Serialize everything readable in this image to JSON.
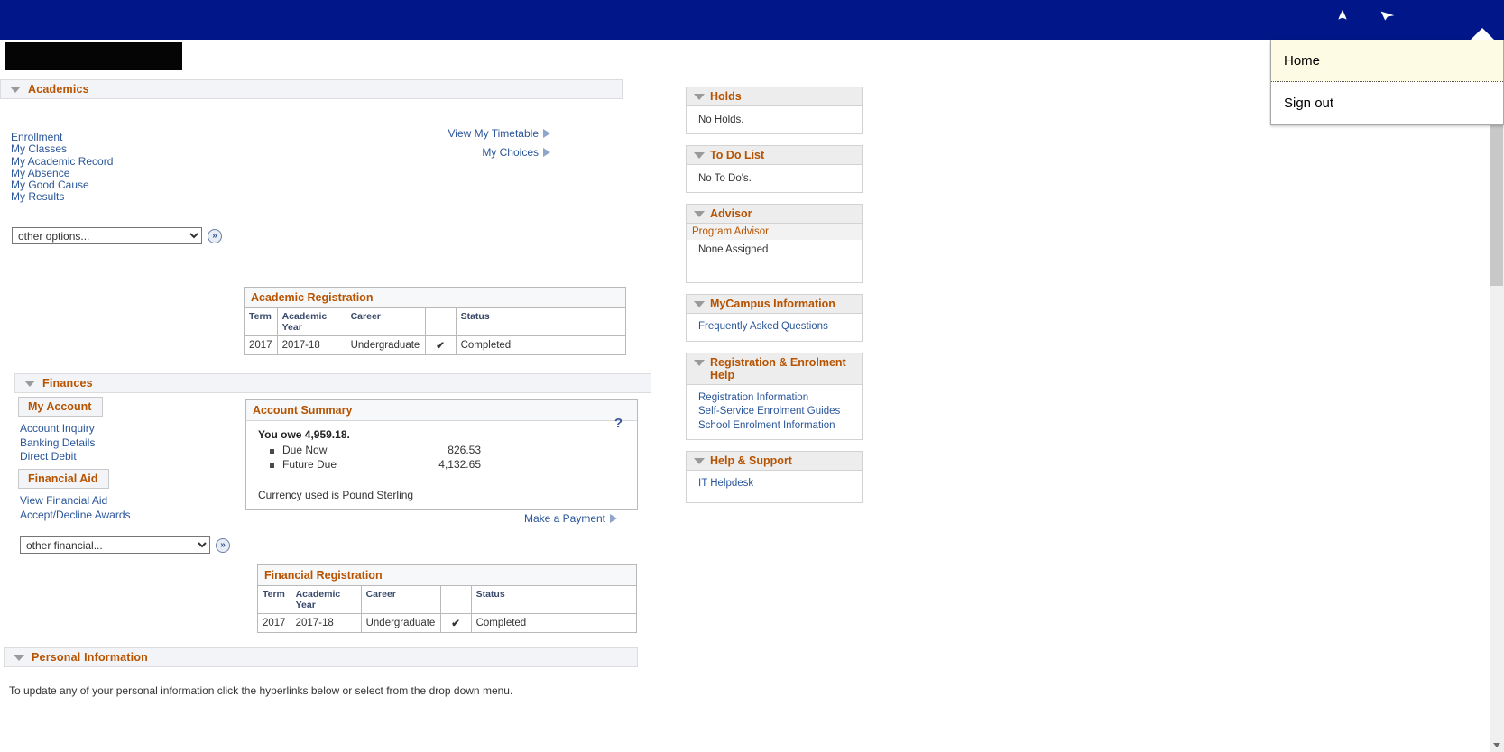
{
  "topbar": {
    "bg_color": "#001689",
    "icons": [
      {
        "name": "star-icon",
        "label": "Favourites"
      },
      {
        "name": "cursor-icon",
        "label": "Navigator"
      }
    ]
  },
  "user_menu": {
    "items": [
      {
        "label": "Home",
        "selected": true
      },
      {
        "label": "Sign out",
        "selected": false
      }
    ]
  },
  "page": {
    "redacted_title": "",
    "accent_color": "#b75300",
    "link_color": "#2a5699"
  },
  "academics": {
    "group_label": "Academics",
    "links": [
      {
        "label": "Enrollment"
      },
      {
        "label": "My Classes"
      },
      {
        "label": "My Academic Record"
      },
      {
        "label": "My Absence"
      },
      {
        "label": "My Good Cause"
      },
      {
        "label": "My Results"
      }
    ],
    "action_links": [
      {
        "label": "View My Timetable"
      },
      {
        "label": "My Choices"
      }
    ],
    "dropdown": {
      "value": "other options...",
      "options": [
        "other options..."
      ],
      "go_label": "»"
    },
    "registration_table": {
      "title": "Academic Registration",
      "columns": [
        "Term",
        "Academic Year",
        "Career",
        "",
        "Status"
      ],
      "rows": [
        [
          "2017",
          "2017-18",
          "Undergraduate",
          "✔",
          "Completed"
        ]
      ]
    }
  },
  "finances": {
    "group_label": "Finances",
    "my_account": {
      "tab_label": "My Account",
      "links": [
        {
          "label": "Account Inquiry"
        },
        {
          "label": "Banking Details"
        },
        {
          "label": "Direct Debit"
        }
      ]
    },
    "financial_aid": {
      "tab_label": "Financial Aid",
      "links": [
        {
          "label": "View Financial Aid"
        },
        {
          "label": "Accept/Decline Awards"
        }
      ]
    },
    "account_summary": {
      "title": "Account Summary",
      "owe_text": "You owe 4,959.18.",
      "rows": [
        {
          "label": "Due Now",
          "value": "826.53"
        },
        {
          "label": "Future Due",
          "value": "4,132.65"
        }
      ],
      "currency_note": "Currency used is Pound Sterling",
      "help_glyph": "?"
    },
    "make_payment_label": "Make a Payment",
    "dropdown": {
      "value": "other financial...",
      "options": [
        "other financial..."
      ],
      "go_label": "»"
    },
    "registration_table": {
      "title": "Financial Registration",
      "columns": [
        "Term",
        "Academic Year",
        "Career",
        "",
        "Status"
      ],
      "rows": [
        [
          "2017",
          "2017-18",
          "Undergraduate",
          "✔",
          "Completed"
        ]
      ]
    }
  },
  "personal_information": {
    "group_label": "Personal Information",
    "intro": "To update any of your personal information click the hyperlinks below or select from the drop down menu."
  },
  "right_panels": [
    {
      "name": "holds",
      "title": "Holds",
      "text": "No Holds.",
      "links": []
    },
    {
      "name": "to-do-list",
      "title": "To Do List",
      "text": "No To Do's.",
      "links": []
    },
    {
      "name": "advisor",
      "title": "Advisor",
      "subheading": "Program Advisor",
      "value": "None Assigned",
      "links": []
    },
    {
      "name": "mycampus-information",
      "title": "MyCampus Information",
      "links": [
        {
          "label": "Frequently Asked Questions"
        }
      ]
    },
    {
      "name": "registration-enrolment-help",
      "title": "Registration & Enrolment Help",
      "links": [
        {
          "label": "Registration Information"
        },
        {
          "label": "Self-Service Enrolment Guides"
        },
        {
          "label": "School Enrolment Information"
        }
      ]
    },
    {
      "name": "help-support",
      "title": "Help & Support",
      "links": [
        {
          "label": "IT Helpdesk"
        }
      ]
    }
  ]
}
